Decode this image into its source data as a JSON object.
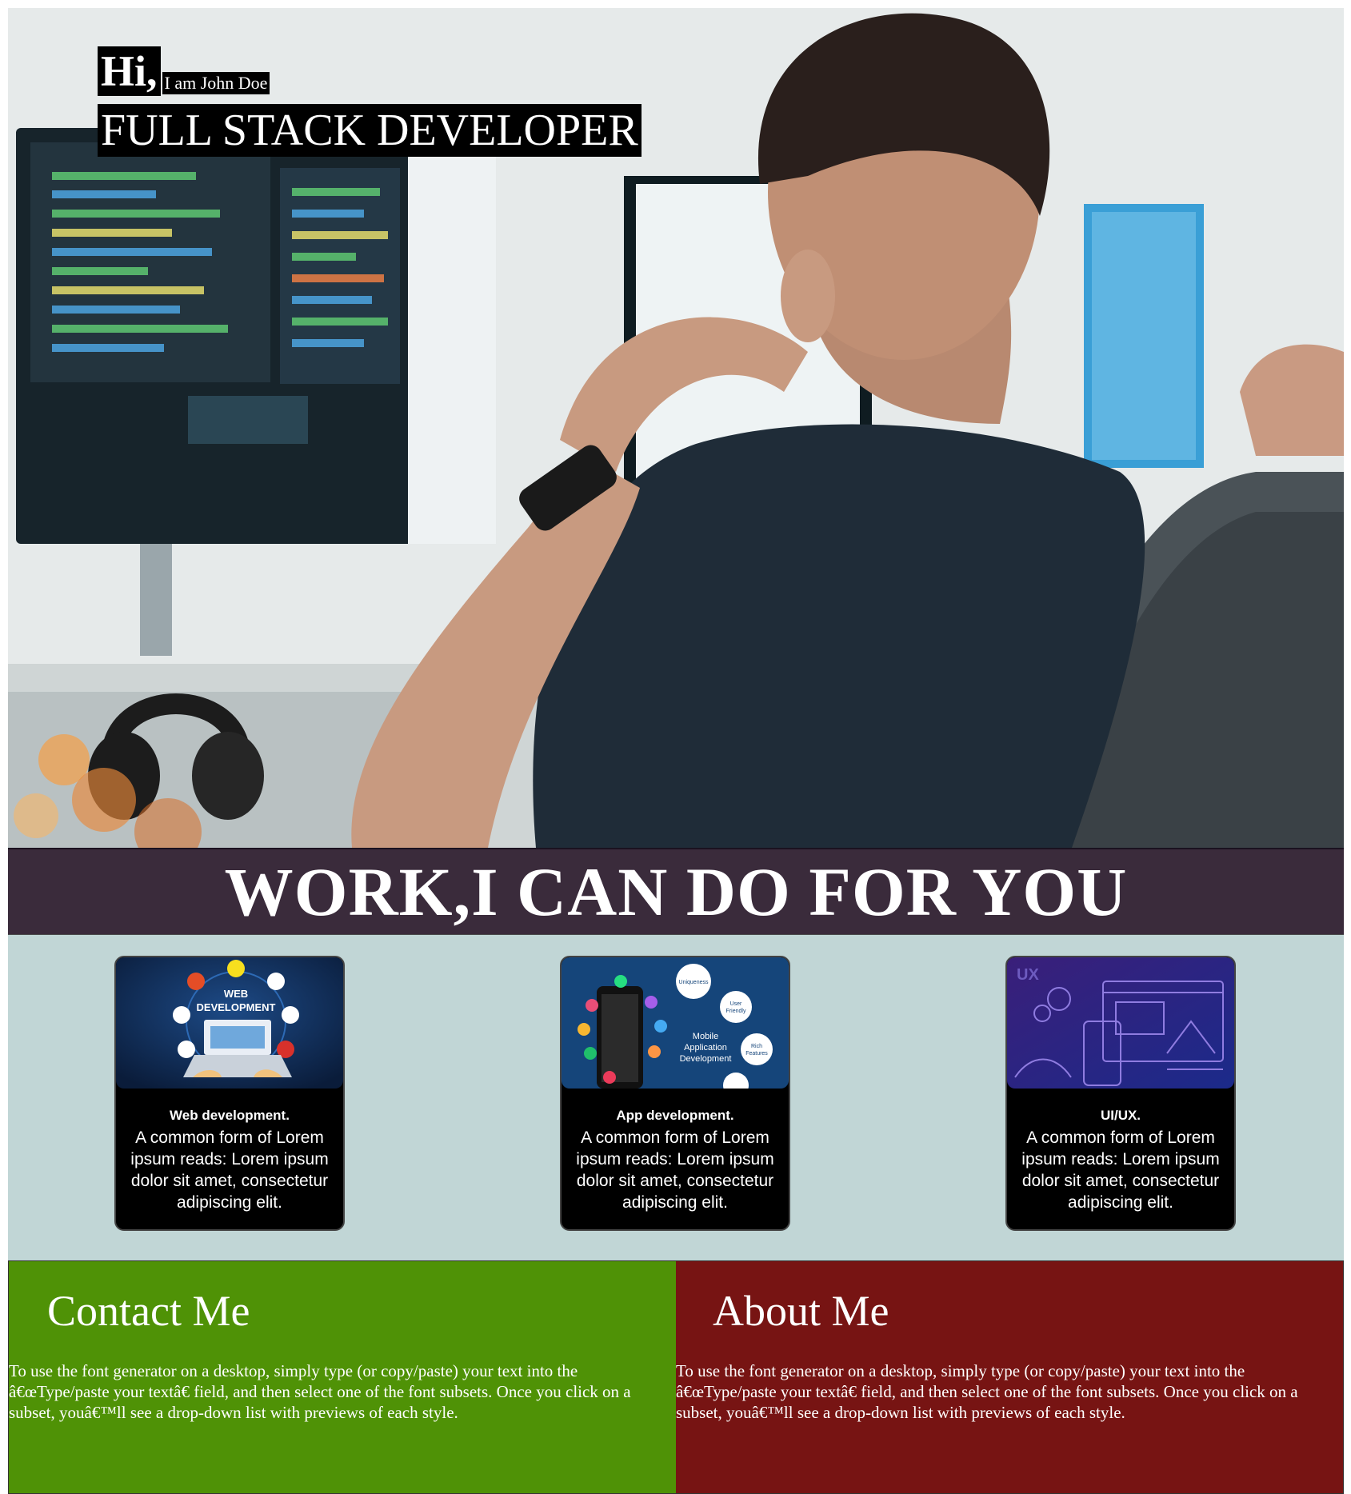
{
  "hero": {
    "greeting": "Hi,",
    "name": "I am John Doe",
    "role": "FULL STACK DEVELOPER"
  },
  "services": {
    "heading": "WORK,I CAN DO FOR YOU",
    "cards": [
      {
        "image_labels": [
          "WEB",
          "DEVELOPMENT"
        ],
        "title": "Web development.",
        "text": "A common form of Lorem ipsum reads: Lorem ipsum dolor sit amet, consectetur adipiscing elit."
      },
      {
        "image_labels": [
          "Mobile",
          "Application",
          "Development",
          "Uniqueness",
          "User",
          "Friendly",
          "Rich",
          "Features"
        ],
        "title": "App development.",
        "text": "A common form of Lorem ipsum reads: Lorem ipsum dolor sit amet, consectetur adipiscing elit."
      },
      {
        "image_labels": [
          "UX"
        ],
        "title": "UI/UX.",
        "text": "A common form of Lorem ipsum reads: Lorem ipsum dolor sit amet, consectetur adipiscing elit."
      }
    ]
  },
  "contact": {
    "title": "Contact Me",
    "text": "To use the font generator on a desktop, simply type (or copy/paste) your text into the â€œType/paste your textâ€    field, and then select one of the font subsets. Once you click on a subset, youâ€™ll see a drop-down list with previews of each style."
  },
  "about": {
    "title": "About Me",
    "text": "To use the font generator on a desktop, simply type (or copy/paste) your text into the â€œType/paste your textâ€    field, and then select one of the font subsets. Once you click on a subset, youâ€™ll see a drop-down list with previews of each style."
  },
  "colors": {
    "banner": "#3a2b3b",
    "services_bg": "#c1d6d6",
    "contact_bg": "#4f9206",
    "about_bg": "#771413",
    "card_bg": "#000000"
  }
}
